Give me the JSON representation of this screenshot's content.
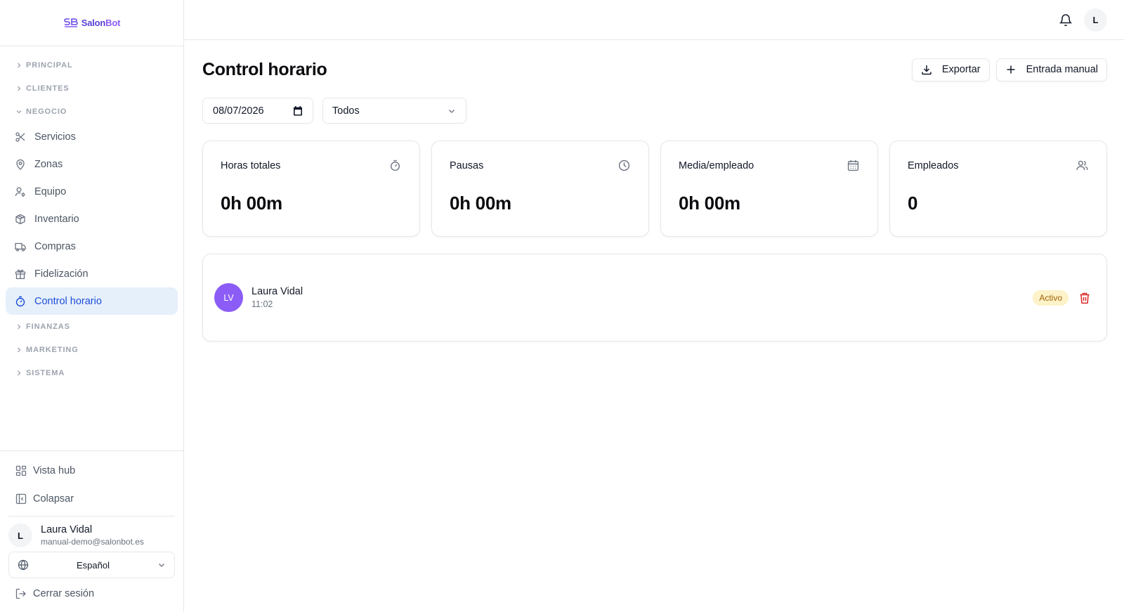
{
  "brand": {
    "name_a": "Salon",
    "name_b": "Bot"
  },
  "sidebar": {
    "sections": {
      "principal": "PRINCIPAL",
      "clientes": "CLIENTES",
      "negocio": "NEGOCIO",
      "finanzas": "FINANZAS",
      "marketing": "MARKETING",
      "sistema": "SISTEMA"
    },
    "items": {
      "servicios": "Servicios",
      "zonas": "Zonas",
      "equipo": "Equipo",
      "inventario": "Inventario",
      "compras": "Compras",
      "fidelizacion": "Fidelización",
      "control_horario": "Control horario"
    },
    "bottom": {
      "vista_hub": "Vista hub",
      "colapsar": "Colapsar",
      "cerrar_sesion": "Cerrar sesión"
    },
    "user": {
      "initial": "L",
      "name": "Laura Vidal",
      "email": "manual-demo@salonbot.es"
    },
    "language": "Español"
  },
  "topbar": {
    "avatar_initial": "L"
  },
  "page": {
    "title": "Control horario",
    "export_label": "Exportar",
    "manual_entry_label": "Entrada manual"
  },
  "filters": {
    "date": "08/07/2026",
    "employee": "Todos"
  },
  "stats": [
    {
      "label": "Horas totales",
      "value": "0h 00m",
      "icon": "stopwatch-icon"
    },
    {
      "label": "Pausas",
      "value": "0h 00m",
      "icon": "clock-icon"
    },
    {
      "label": "Media/empleado",
      "value": "0h 00m",
      "icon": "calendar-icon"
    },
    {
      "label": "Empleados",
      "value": "0",
      "icon": "users-icon"
    }
  ],
  "entries": [
    {
      "initials": "LV",
      "name": "Laura Vidal",
      "time": "11:02",
      "status": "Activo"
    }
  ],
  "colors": {
    "accent": "#1d4ed8",
    "active_bg": "#e6f0fb",
    "avatar": "#8b5cf6",
    "badge_bg": "#fdf2c8",
    "badge_text": "#a16207",
    "danger": "#dc2626"
  }
}
